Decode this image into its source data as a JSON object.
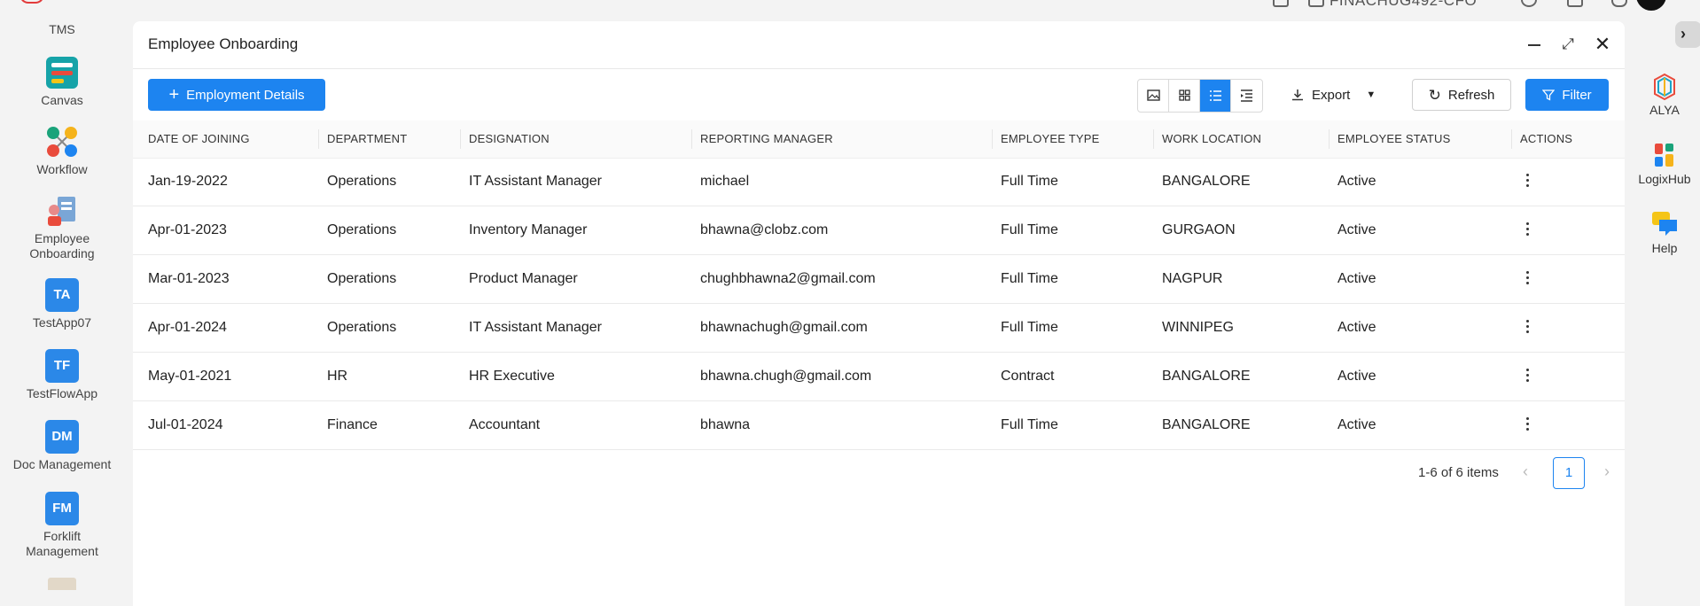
{
  "topbar": {
    "org_name": "FINACHUG492-CFO"
  },
  "sidebar": {
    "items": [
      {
        "label": "TMS"
      },
      {
        "label": "Canvas"
      },
      {
        "label": "Workflow"
      },
      {
        "label_line1": "Employee",
        "label_line2": "Onboarding"
      },
      {
        "abbr": "TA",
        "label": "TestApp07"
      },
      {
        "abbr": "TF",
        "label": "TestFlowApp"
      },
      {
        "abbr": "DM",
        "label": "Doc Management"
      },
      {
        "abbr": "FM",
        "label_line1": "Forklift",
        "label_line2": "Management"
      }
    ]
  },
  "rail": {
    "items": [
      {
        "label": "ALYA"
      },
      {
        "label": "LogixHub"
      },
      {
        "label": "Help"
      }
    ]
  },
  "panel": {
    "title": "Employee Onboarding"
  },
  "toolbar": {
    "add_label": "Employment Details",
    "export_label": "Export",
    "refresh_label": "Refresh",
    "filter_label": "Filter"
  },
  "table": {
    "columns": [
      "DATE OF JOINING",
      "DEPARTMENT",
      "DESIGNATION",
      "REPORTING MANAGER",
      "EMPLOYEE TYPE",
      "WORK LOCATION",
      "EMPLOYEE STATUS",
      "ACTIONS"
    ],
    "rows": [
      [
        "Jan-19-2022",
        "Operations",
        "IT Assistant Manager",
        "michael",
        "Full Time",
        "BANGALORE",
        "Active"
      ],
      [
        "Apr-01-2023",
        "Operations",
        "Inventory Manager",
        "bhawna@clobz.com",
        "Full Time",
        "GURGAON",
        "Active"
      ],
      [
        "Mar-01-2023",
        "Operations",
        "Product Manager",
        "chughbhawna2@gmail.com",
        "Full Time",
        "NAGPUR",
        "Active"
      ],
      [
        "Apr-01-2024",
        "Operations",
        "IT Assistant Manager",
        "bhawnachugh@gmail.com",
        "Full Time",
        "WINNIPEG",
        "Active"
      ],
      [
        "May-01-2021",
        "HR",
        "HR Executive",
        "bhawna.chugh@gmail.com",
        "Contract",
        "BANGALORE",
        "Active"
      ],
      [
        "Jul-01-2024",
        "Finance",
        "Accountant",
        "bhawna",
        "Full Time",
        "BANGALORE",
        "Active"
      ]
    ]
  },
  "pagination": {
    "summary": "1-6 of 6 items",
    "current_page": "1"
  },
  "colors": {
    "accent": "#1d84f0",
    "tile": "#2b88e8"
  }
}
